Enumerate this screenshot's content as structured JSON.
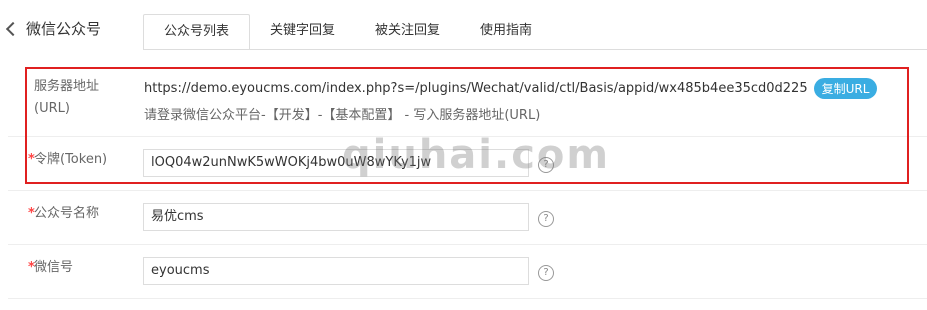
{
  "header": {
    "back_label": "微信公众号",
    "tabs": [
      "公众号列表",
      "关键字回复",
      "被关注回复",
      "使用指南"
    ]
  },
  "form": {
    "server": {
      "label_line1": "服务器地址",
      "label_line2": "(URL)",
      "url": "https://demo.eyoucms.com/index.php?s=/plugins/Wechat/valid/ctl/Basis/appid/wx485b4ee35cd0d225",
      "copy_button": "复制URL",
      "hint": "请登录微信公众平台-【开发】-【基本配置】 - 写入服务器地址(URL)"
    },
    "token": {
      "required": "*",
      "label": "令牌(Token)",
      "value": "lOQ04w2unNwK5wWOKj4bw0uW8wYKy1jw"
    },
    "account_name": {
      "required": "*",
      "label": "公众号名称",
      "value": "易优cms"
    },
    "wechat_id": {
      "required": "*",
      "label": "微信号",
      "value": "eyoucms"
    },
    "help_glyph": "?"
  },
  "watermark": "qiuhai.com"
}
